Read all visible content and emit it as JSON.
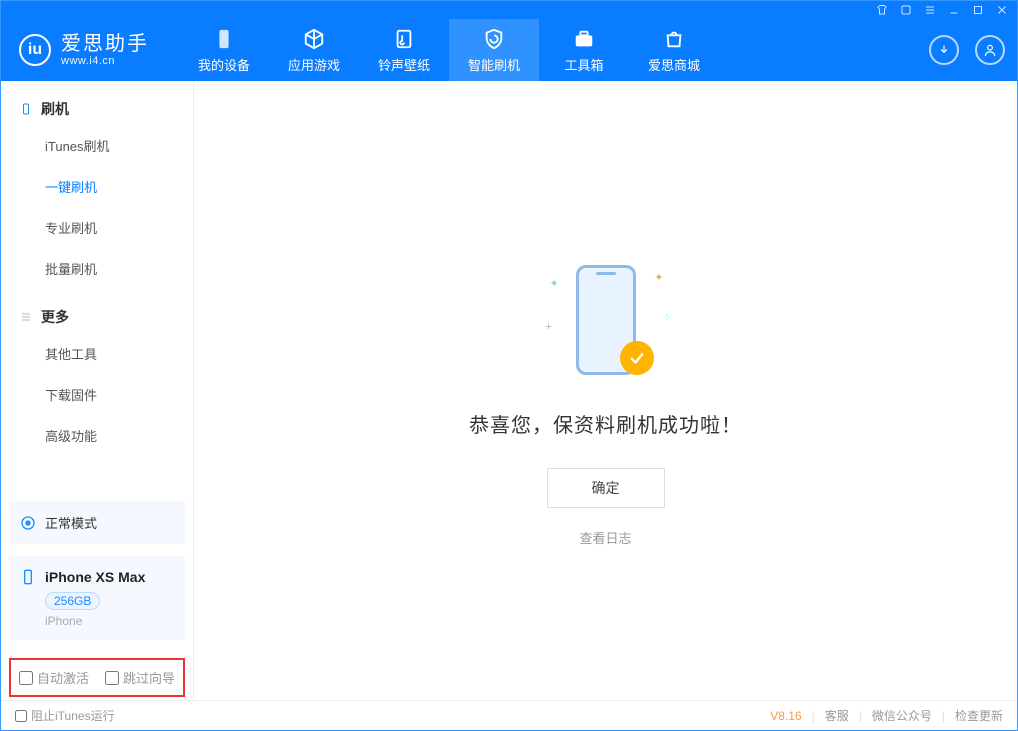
{
  "app": {
    "name_cn": "爱思助手",
    "url": "www.i4.cn"
  },
  "nav": {
    "items": [
      {
        "label": "我的设备"
      },
      {
        "label": "应用游戏"
      },
      {
        "label": "铃声壁纸"
      },
      {
        "label": "智能刷机"
      },
      {
        "label": "工具箱"
      },
      {
        "label": "爱思商城"
      }
    ]
  },
  "sidebar": {
    "flash": {
      "title": "刷机",
      "items": [
        "iTunes刷机",
        "一键刷机",
        "专业刷机",
        "批量刷机"
      ]
    },
    "more": {
      "title": "更多",
      "items": [
        "其他工具",
        "下载固件",
        "高级功能"
      ]
    },
    "mode": {
      "label": "正常模式"
    },
    "device": {
      "name": "iPhone XS Max",
      "storage": "256GB",
      "type": "iPhone"
    },
    "options": {
      "auto_activate": "自动激活",
      "skip_guide": "跳过向导"
    }
  },
  "main": {
    "success": "恭喜您，保资料刷机成功啦！",
    "ok_button": "确定",
    "view_log": "查看日志"
  },
  "footer": {
    "block_itunes": "阻止iTunes运行",
    "version": "V8.16",
    "links": [
      "客服",
      "微信公众号",
      "检查更新"
    ]
  }
}
